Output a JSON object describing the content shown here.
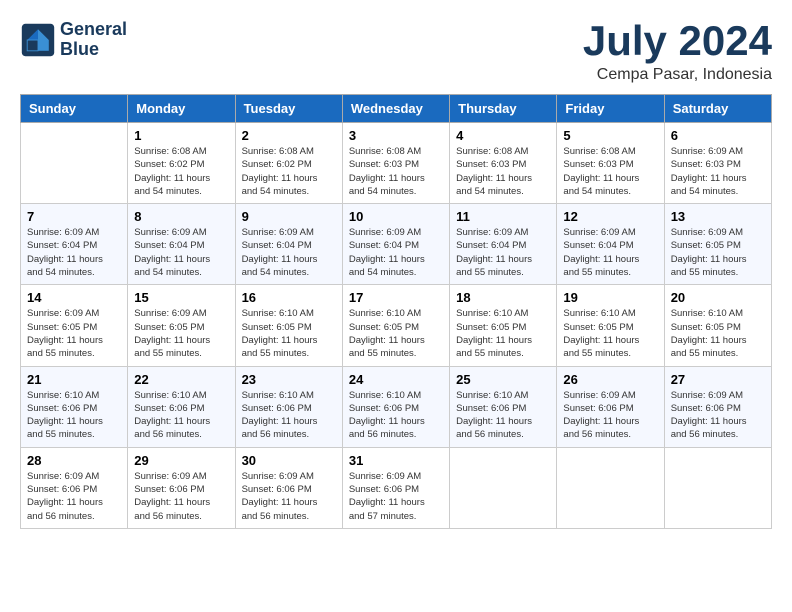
{
  "header": {
    "logo_line1": "General",
    "logo_line2": "Blue",
    "month_year": "July 2024",
    "location": "Cempa Pasar, Indonesia"
  },
  "days_of_week": [
    "Sunday",
    "Monday",
    "Tuesday",
    "Wednesday",
    "Thursday",
    "Friday",
    "Saturday"
  ],
  "weeks": [
    [
      {
        "day": "",
        "info": ""
      },
      {
        "day": "1",
        "info": "Sunrise: 6:08 AM\nSunset: 6:02 PM\nDaylight: 11 hours\nand 54 minutes."
      },
      {
        "day": "2",
        "info": "Sunrise: 6:08 AM\nSunset: 6:02 PM\nDaylight: 11 hours\nand 54 minutes."
      },
      {
        "day": "3",
        "info": "Sunrise: 6:08 AM\nSunset: 6:03 PM\nDaylight: 11 hours\nand 54 minutes."
      },
      {
        "day": "4",
        "info": "Sunrise: 6:08 AM\nSunset: 6:03 PM\nDaylight: 11 hours\nand 54 minutes."
      },
      {
        "day": "5",
        "info": "Sunrise: 6:08 AM\nSunset: 6:03 PM\nDaylight: 11 hours\nand 54 minutes."
      },
      {
        "day": "6",
        "info": "Sunrise: 6:09 AM\nSunset: 6:03 PM\nDaylight: 11 hours\nand 54 minutes."
      }
    ],
    [
      {
        "day": "7",
        "info": "Sunrise: 6:09 AM\nSunset: 6:04 PM\nDaylight: 11 hours\nand 54 minutes."
      },
      {
        "day": "8",
        "info": "Sunrise: 6:09 AM\nSunset: 6:04 PM\nDaylight: 11 hours\nand 54 minutes."
      },
      {
        "day": "9",
        "info": "Sunrise: 6:09 AM\nSunset: 6:04 PM\nDaylight: 11 hours\nand 54 minutes."
      },
      {
        "day": "10",
        "info": "Sunrise: 6:09 AM\nSunset: 6:04 PM\nDaylight: 11 hours\nand 54 minutes."
      },
      {
        "day": "11",
        "info": "Sunrise: 6:09 AM\nSunset: 6:04 PM\nDaylight: 11 hours\nand 55 minutes."
      },
      {
        "day": "12",
        "info": "Sunrise: 6:09 AM\nSunset: 6:04 PM\nDaylight: 11 hours\nand 55 minutes."
      },
      {
        "day": "13",
        "info": "Sunrise: 6:09 AM\nSunset: 6:05 PM\nDaylight: 11 hours\nand 55 minutes."
      }
    ],
    [
      {
        "day": "14",
        "info": "Sunrise: 6:09 AM\nSunset: 6:05 PM\nDaylight: 11 hours\nand 55 minutes."
      },
      {
        "day": "15",
        "info": "Sunrise: 6:09 AM\nSunset: 6:05 PM\nDaylight: 11 hours\nand 55 minutes."
      },
      {
        "day": "16",
        "info": "Sunrise: 6:10 AM\nSunset: 6:05 PM\nDaylight: 11 hours\nand 55 minutes."
      },
      {
        "day": "17",
        "info": "Sunrise: 6:10 AM\nSunset: 6:05 PM\nDaylight: 11 hours\nand 55 minutes."
      },
      {
        "day": "18",
        "info": "Sunrise: 6:10 AM\nSunset: 6:05 PM\nDaylight: 11 hours\nand 55 minutes."
      },
      {
        "day": "19",
        "info": "Sunrise: 6:10 AM\nSunset: 6:05 PM\nDaylight: 11 hours\nand 55 minutes."
      },
      {
        "day": "20",
        "info": "Sunrise: 6:10 AM\nSunset: 6:05 PM\nDaylight: 11 hours\nand 55 minutes."
      }
    ],
    [
      {
        "day": "21",
        "info": "Sunrise: 6:10 AM\nSunset: 6:06 PM\nDaylight: 11 hours\nand 55 minutes."
      },
      {
        "day": "22",
        "info": "Sunrise: 6:10 AM\nSunset: 6:06 PM\nDaylight: 11 hours\nand 56 minutes."
      },
      {
        "day": "23",
        "info": "Sunrise: 6:10 AM\nSunset: 6:06 PM\nDaylight: 11 hours\nand 56 minutes."
      },
      {
        "day": "24",
        "info": "Sunrise: 6:10 AM\nSunset: 6:06 PM\nDaylight: 11 hours\nand 56 minutes."
      },
      {
        "day": "25",
        "info": "Sunrise: 6:10 AM\nSunset: 6:06 PM\nDaylight: 11 hours\nand 56 minutes."
      },
      {
        "day": "26",
        "info": "Sunrise: 6:09 AM\nSunset: 6:06 PM\nDaylight: 11 hours\nand 56 minutes."
      },
      {
        "day": "27",
        "info": "Sunrise: 6:09 AM\nSunset: 6:06 PM\nDaylight: 11 hours\nand 56 minutes."
      }
    ],
    [
      {
        "day": "28",
        "info": "Sunrise: 6:09 AM\nSunset: 6:06 PM\nDaylight: 11 hours\nand 56 minutes."
      },
      {
        "day": "29",
        "info": "Sunrise: 6:09 AM\nSunset: 6:06 PM\nDaylight: 11 hours\nand 56 minutes."
      },
      {
        "day": "30",
        "info": "Sunrise: 6:09 AM\nSunset: 6:06 PM\nDaylight: 11 hours\nand 56 minutes."
      },
      {
        "day": "31",
        "info": "Sunrise: 6:09 AM\nSunset: 6:06 PM\nDaylight: 11 hours\nand 57 minutes."
      },
      {
        "day": "",
        "info": ""
      },
      {
        "day": "",
        "info": ""
      },
      {
        "day": "",
        "info": ""
      }
    ]
  ]
}
